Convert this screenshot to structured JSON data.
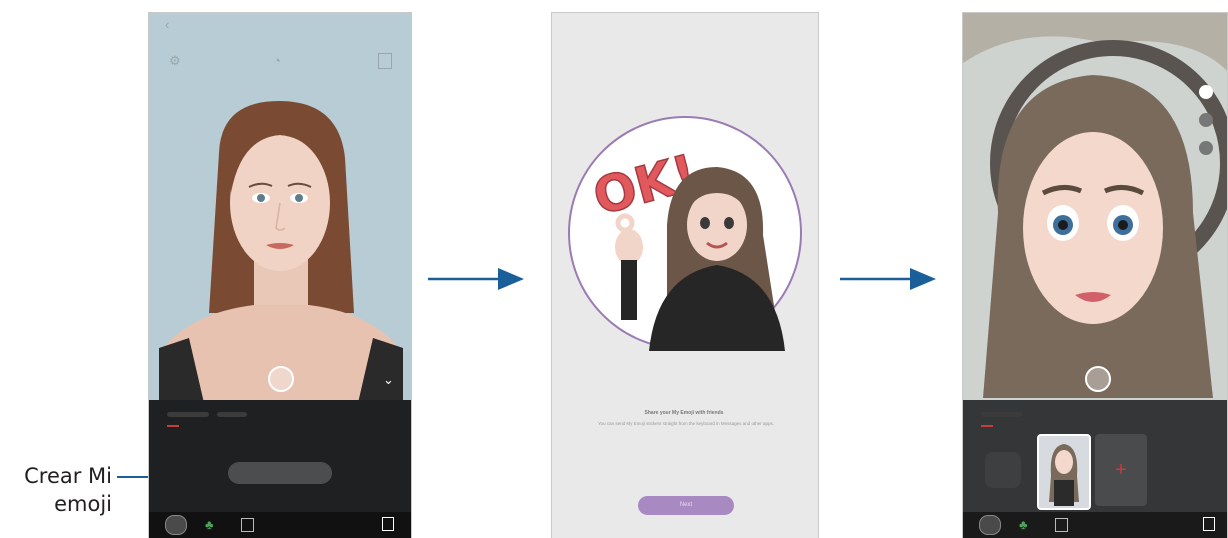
{
  "callout": {
    "line1": "Crear Mi",
    "line2": "emoji"
  },
  "step2": {
    "ok_text": "OK!",
    "share_title": "Share your My Emoji with friends",
    "share_desc": "You can send My Emoji stickers straight from the keyboard in Messages and other apps.",
    "button_label": "Next"
  },
  "step3": {
    "add_symbol": "+"
  },
  "colors": {
    "arrow": "#1a5e9a",
    "circle_border": "#9b7bb4",
    "button": "#a889c1",
    "accent_red": "#c63b3b"
  },
  "icons": [
    "back-icon",
    "settings-icon",
    "timer-icon",
    "ratio-icon",
    "chevron-down-icon",
    "gallery-icon",
    "effects-icon",
    "mask-icon",
    "plus-icon"
  ]
}
